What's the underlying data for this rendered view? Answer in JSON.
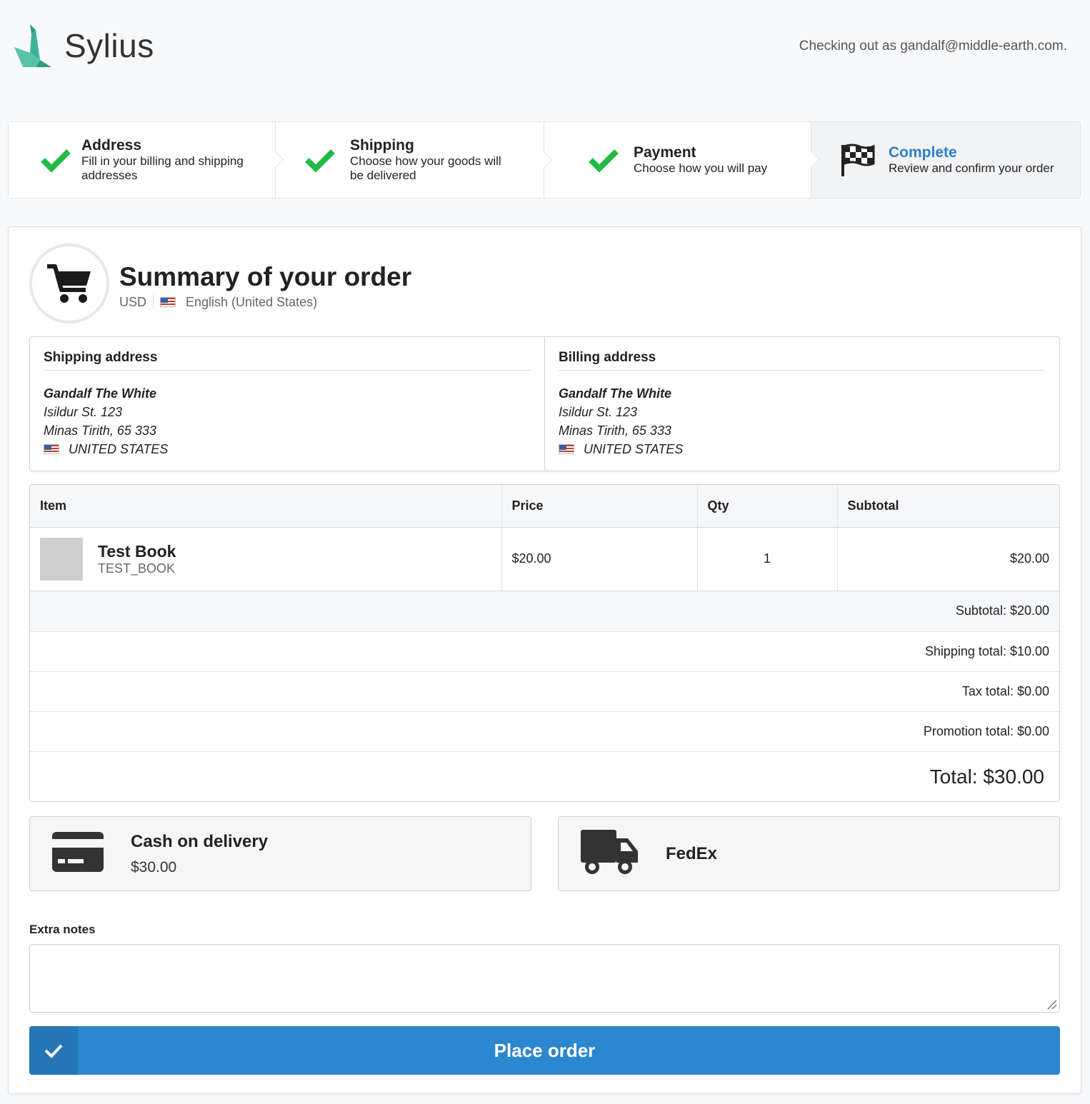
{
  "brand": {
    "name": "Sylius",
    "accent": "#2b87cf",
    "logo_color": "#3fb19a"
  },
  "header": {
    "checkout_as": "Checking out as gandalf@middle-earth.com."
  },
  "steps": [
    {
      "title": "Address",
      "desc": "Fill in your billing and shipping addresses",
      "icon": "check-icon",
      "state": "done"
    },
    {
      "title": "Shipping",
      "desc": "Choose how your goods will be delivered",
      "icon": "check-icon",
      "state": "done"
    },
    {
      "title": "Payment",
      "desc": "Choose how you will pay",
      "icon": "check-icon",
      "state": "done"
    },
    {
      "title": "Complete",
      "desc": "Review and confirm your order",
      "icon": "flag-checkered-icon",
      "state": "active"
    }
  ],
  "summary": {
    "title": "Summary of your order",
    "currency": "USD",
    "locale": "English (United States)"
  },
  "shipping_address": {
    "title": "Shipping address",
    "name": "Gandalf The White",
    "street": "Isildur St. 123",
    "city": "Minas Tirith, 65 333",
    "country": "UNITED STATES"
  },
  "billing_address": {
    "title": "Billing address",
    "name": "Gandalf The White",
    "street": "Isildur St. 123",
    "city": "Minas Tirith, 65 333",
    "country": "UNITED STATES"
  },
  "items_table": {
    "headers": [
      "Item",
      "Price",
      "Qty",
      "Subtotal"
    ],
    "rows": [
      {
        "name": "Test Book",
        "code": "TEST_BOOK",
        "price": "$20.00",
        "qty": "1",
        "subtotal": "$20.00"
      }
    ]
  },
  "totals": {
    "subtotal": "Subtotal: $20.00",
    "shipping": "Shipping total: $10.00",
    "tax": "Tax total: $0.00",
    "promotion": "Promotion total: $0.00",
    "total": "Total: $30.00"
  },
  "payment": {
    "method": "Cash on delivery",
    "amount": "$30.00",
    "icon": "credit-card-icon"
  },
  "shipment": {
    "method": "FedEx",
    "icon": "truck-icon"
  },
  "notes": {
    "label": "Extra notes",
    "value": ""
  },
  "place_order": {
    "label": "Place order",
    "icon": "check-icon"
  }
}
